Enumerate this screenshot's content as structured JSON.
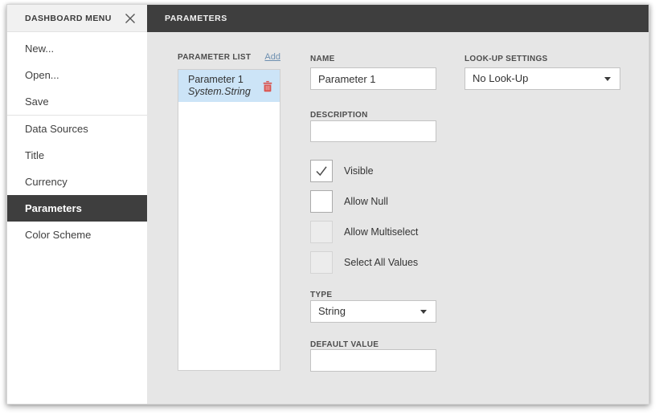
{
  "sidebar": {
    "header": "DASHBOARD MENU",
    "items": [
      {
        "label": "New..."
      },
      {
        "label": "Open..."
      },
      {
        "label": "Save"
      },
      {
        "label": "Data Sources"
      },
      {
        "label": "Title"
      },
      {
        "label": "Currency"
      },
      {
        "label": "Parameters",
        "selected": true
      },
      {
        "label": "Color Scheme"
      }
    ]
  },
  "header": {
    "title": "PARAMETERS"
  },
  "parameter_list": {
    "label": "PARAMETER LIST",
    "add_label": "Add",
    "items": [
      {
        "name": "Parameter 1",
        "type": "System.String",
        "selected": true
      }
    ]
  },
  "form": {
    "name": {
      "label": "NAME",
      "value": "Parameter 1"
    },
    "look_up_settings": {
      "label": "LOOK-UP SETTINGS",
      "value": "No Look-Up"
    },
    "description": {
      "label": "DESCRIPTION",
      "value": ""
    },
    "checkboxes": [
      {
        "label": "Visible",
        "checked": true,
        "enabled": true
      },
      {
        "label": "Allow Null",
        "checked": false,
        "enabled": true
      },
      {
        "label": "Allow Multiselect",
        "checked": false,
        "enabled": false
      },
      {
        "label": "Select All Values",
        "checked": false,
        "enabled": false
      }
    ],
    "type": {
      "label": "TYPE",
      "value": "String"
    },
    "default_value": {
      "label": "DEFAULT VALUE",
      "value": ""
    }
  },
  "colors": {
    "titlebar_dark": "#3e3e3e",
    "content_background": "#e6e6e6",
    "selection_blue": "#cce4f7",
    "link_blue": "#6d8fb0",
    "delete_red": "#d9534f"
  }
}
